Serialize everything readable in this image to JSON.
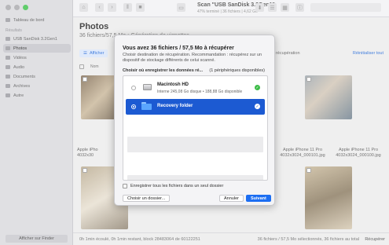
{
  "sidebar": {
    "items_top": [
      {
        "label": "Tableau de bord",
        "icon": "dashboard-icon"
      }
    ],
    "section": "Résultats",
    "items": [
      {
        "label": "USB SanDisk 3.2Gen1",
        "icon": "usb-drive-icon"
      },
      {
        "label": "Photos",
        "icon": "photos-icon"
      },
      {
        "label": "Vidéos",
        "icon": "video-icon"
      },
      {
        "label": "Audio",
        "icon": "audio-icon"
      },
      {
        "label": "Documents",
        "icon": "document-icon"
      },
      {
        "label": "Archives",
        "icon": "archive-icon"
      },
      {
        "label": "Autre",
        "icon": "folder-icon"
      }
    ],
    "finder_button": "Afficher sur Finder"
  },
  "toolbar": {
    "title": "Scan \"USB SanDisk 3.2Gen1\"",
    "subtitle": "47% terminé | 36 fichiers | 4,62 Go"
  },
  "main": {
    "title": "Photos",
    "subtitle": "36 fichiers/57,5 Mo • Génération de vignettes",
    "filter_label": "Afficher",
    "recovery_tab": "x de récupération",
    "reset_link": "Réinitialiser tout",
    "column_name": "Nom",
    "thumbnails": [
      {
        "label": "Apple iPhone 11 Pro\n4032x3024_000101.jpg"
      },
      {
        "label": "Apple iPhone 11 Pro\n4032x3024_000100.jpg"
      }
    ],
    "left_labels": [
      "Apple iPho",
      "4032x30"
    ]
  },
  "status": {
    "left": "0h 1min écoulé, 0h 1min restant, block 28483064 de 60122251",
    "right": "36 fichiers / 57,5 Mo sélectionnés, 36 fichiers au total",
    "recover": "Récupérer"
  },
  "dialog": {
    "title": "Vous avez 36 fichiers / 57,5 Mo à récupérer",
    "description": "Choisir destination de récupération. Recommandation : récupérez sur un dispositif de stockage différents de celui scanné.",
    "choose_label": "Choisir où enregistrer les données ré...",
    "device_count": "(1 périphériques disponibles)",
    "devices": [
      {
        "name": "Macintosh HD",
        "meta": "Interne 245,08 Go disque • 188,88 Go disponible",
        "selected": false
      },
      {
        "name": "Recovery folder",
        "meta": "",
        "selected": true
      }
    ],
    "save_all_label": "Enregistrer tous les fichiers dans un seul dossier",
    "choose_folder_button": "Choisir un dossier...",
    "cancel_button": "Annuler",
    "next_button": "Suivant"
  }
}
